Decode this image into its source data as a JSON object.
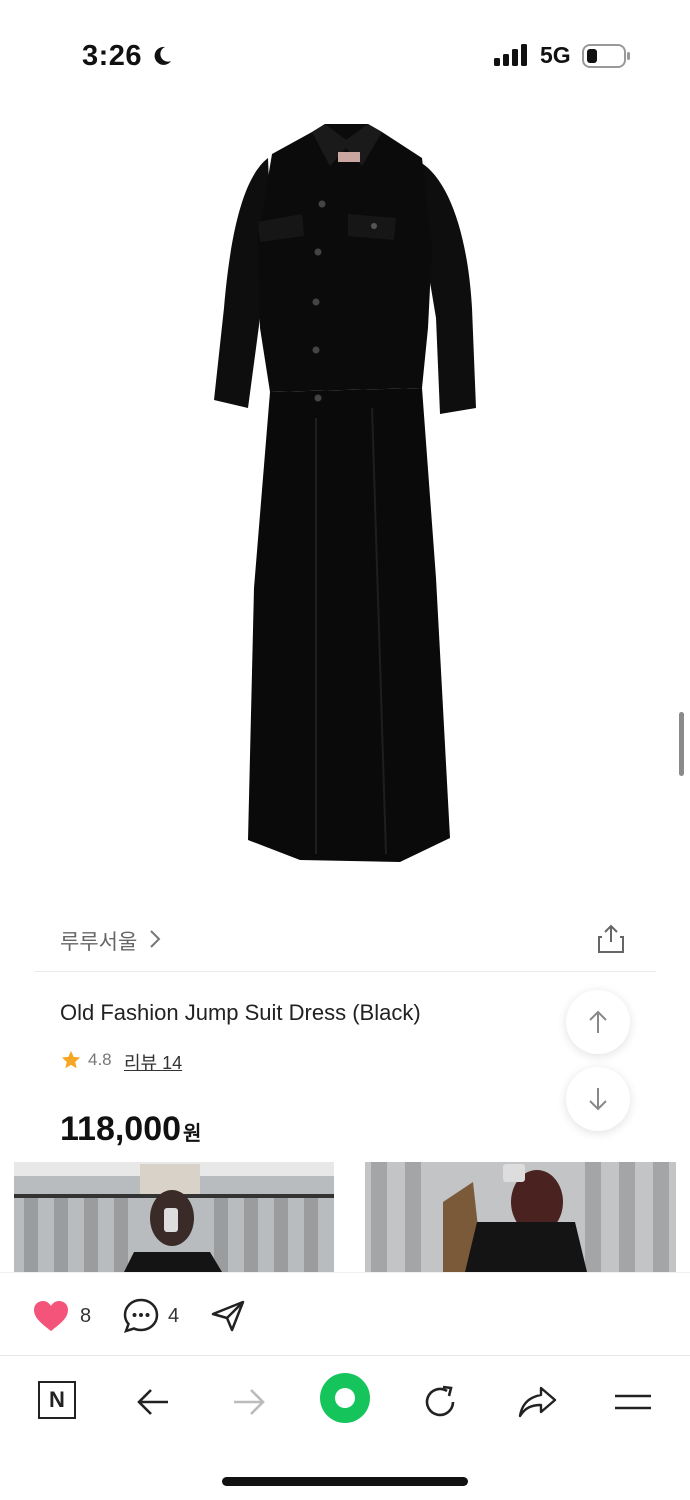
{
  "status_bar": {
    "time": "3:26",
    "network": "5G",
    "icons": [
      "moon-icon",
      "signal-icon",
      "battery-icon"
    ]
  },
  "product": {
    "store_name": "루루서울",
    "title": "Old Fashion Jump Suit Dress (Black)",
    "rating": "4.8",
    "review_label": "리뷰 14",
    "price": "118,000",
    "currency": "원"
  },
  "social": {
    "likes": "8",
    "comments": "4"
  },
  "browser_nav": {
    "logo": "N",
    "icons": [
      "back-arrow-icon",
      "forward-arrow-icon",
      "green-home-icon",
      "refresh-icon",
      "share-arrow-icon",
      "menu-icon"
    ]
  },
  "colors": {
    "accent_green": "#16c45c",
    "heart_pink": "#f4547a",
    "star_orange": "#f5a623"
  }
}
